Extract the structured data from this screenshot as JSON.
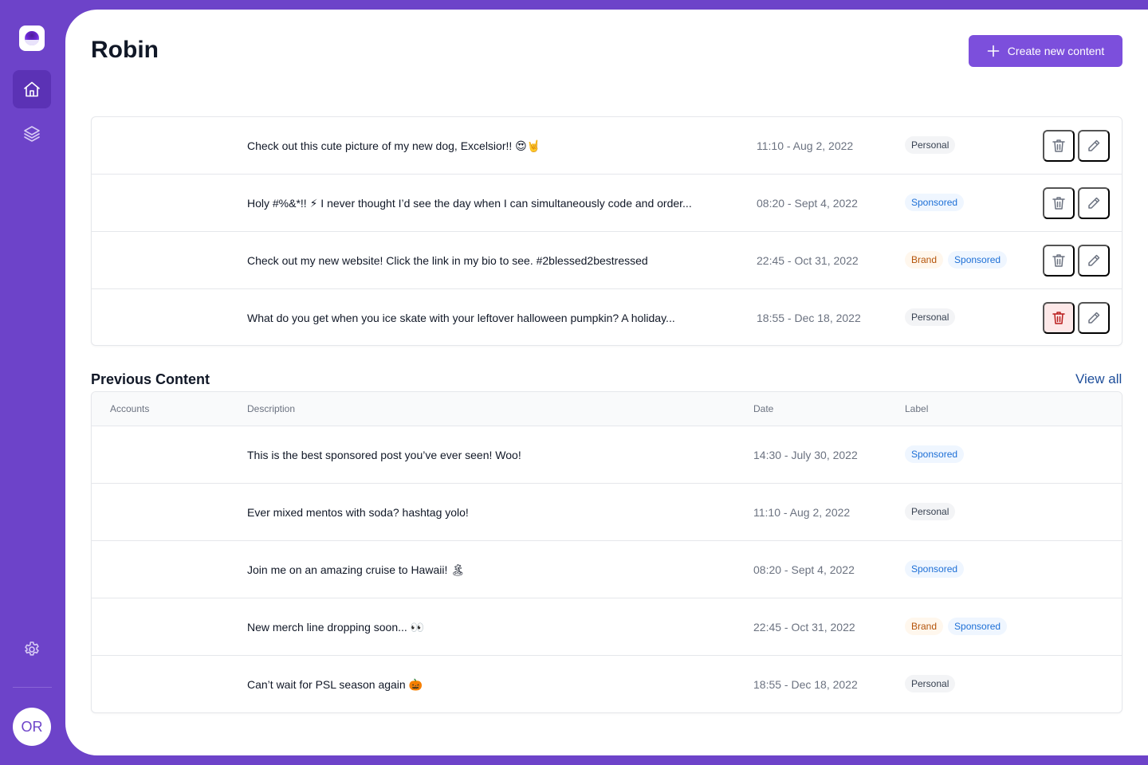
{
  "sidebar": {
    "logo": "orb-logo",
    "nav": [
      {
        "icon": "home-icon",
        "active": true
      },
      {
        "icon": "layers-icon",
        "active": false
      }
    ],
    "settings_icon": "gear-icon",
    "avatar_initials": "OR"
  },
  "header": {
    "title": "Robin",
    "create_button": "Create new content",
    "create_icon": "plus-icon"
  },
  "upcoming": {
    "rows": [
      {
        "description": "Check out this cute picture of my new dog, Excelsior!! 😍🤘",
        "date": "11:10 - Aug 2, 2022",
        "labels": [
          "Personal"
        ]
      },
      {
        "description": "Holy #%&*!! ⚡ I never thought I’d see the day when I can simultaneously code and order...",
        "date": "08:20 - Sept 4, 2022",
        "labels": [
          "Sponsored"
        ]
      },
      {
        "description": "Check out my new website! Click the link in my bio to see. #2blessed2bestressed",
        "date": "22:45 - Oct 31, 2022",
        "labels": [
          "Brand",
          "Sponsored"
        ]
      },
      {
        "description": "What do you get when you ice skate with your leftover halloween pumpkin? A holiday...",
        "date": "18:55 - Dec 18, 2022",
        "labels": [
          "Personal"
        ]
      }
    ]
  },
  "previous": {
    "title": "Previous Content",
    "view_all": "View all",
    "columns": {
      "accounts": "Accounts",
      "description": "Description",
      "date": "Date",
      "label": "Label"
    },
    "rows": [
      {
        "description": "This is the best sponsored post you’ve ever seen! Woo!",
        "date": "14:30 - July 30, 2022",
        "labels": [
          "Sponsored"
        ]
      },
      {
        "description": "Ever mixed mentos with soda? hashtag yolo!",
        "date": "11:10 - Aug 2, 2022",
        "labels": [
          "Personal"
        ]
      },
      {
        "description": "Join me on an amazing cruise to Hawaii! 🏝",
        "date": "08:20 - Sept 4, 2022",
        "labels": [
          "Sponsored"
        ]
      },
      {
        "description": "New merch line dropping soon... 👀",
        "date": "22:45 - Oct 31, 2022",
        "labels": [
          "Brand",
          "Sponsored"
        ]
      },
      {
        "description": "Can’t wait for PSL season again 🎃",
        "date": "18:55 - Dec 18, 2022",
        "labels": [
          "Personal"
        ]
      }
    ]
  },
  "colors": {
    "brand": "#6d43c9",
    "button": "#7c4fdc",
    "sponsored": "#1d6fd6",
    "brand_badge": "#b45309",
    "delete_hover": "#fde8e8"
  }
}
